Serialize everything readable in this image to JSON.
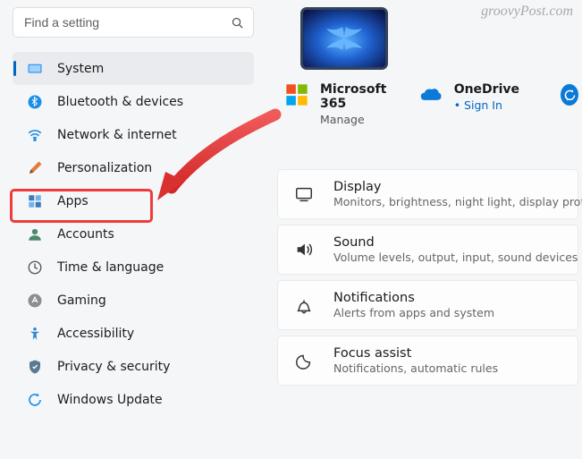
{
  "watermark": "groovyPost.com",
  "search": {
    "placeholder": "Find a setting"
  },
  "nav": {
    "items": [
      {
        "label": "System"
      },
      {
        "label": "Bluetooth & devices"
      },
      {
        "label": "Network & internet"
      },
      {
        "label": "Personalization"
      },
      {
        "label": "Apps"
      },
      {
        "label": "Accounts"
      },
      {
        "label": "Time & language"
      },
      {
        "label": "Gaming"
      },
      {
        "label": "Accessibility"
      },
      {
        "label": "Privacy & security"
      },
      {
        "label": "Windows Update"
      }
    ]
  },
  "header_tiles": {
    "ms365": {
      "title": "Microsoft 365",
      "sub": "Manage"
    },
    "onedrive": {
      "title": "OneDrive",
      "sub": "Sign In"
    }
  },
  "cards": [
    {
      "title": "Display",
      "sub": "Monitors, brightness, night light, display profile"
    },
    {
      "title": "Sound",
      "sub": "Volume levels, output, input, sound devices"
    },
    {
      "title": "Notifications",
      "sub": "Alerts from apps and system"
    },
    {
      "title": "Focus assist",
      "sub": "Notifications, automatic rules"
    }
  ],
  "annotation": {
    "highlight_color": "#ee3c3c"
  }
}
